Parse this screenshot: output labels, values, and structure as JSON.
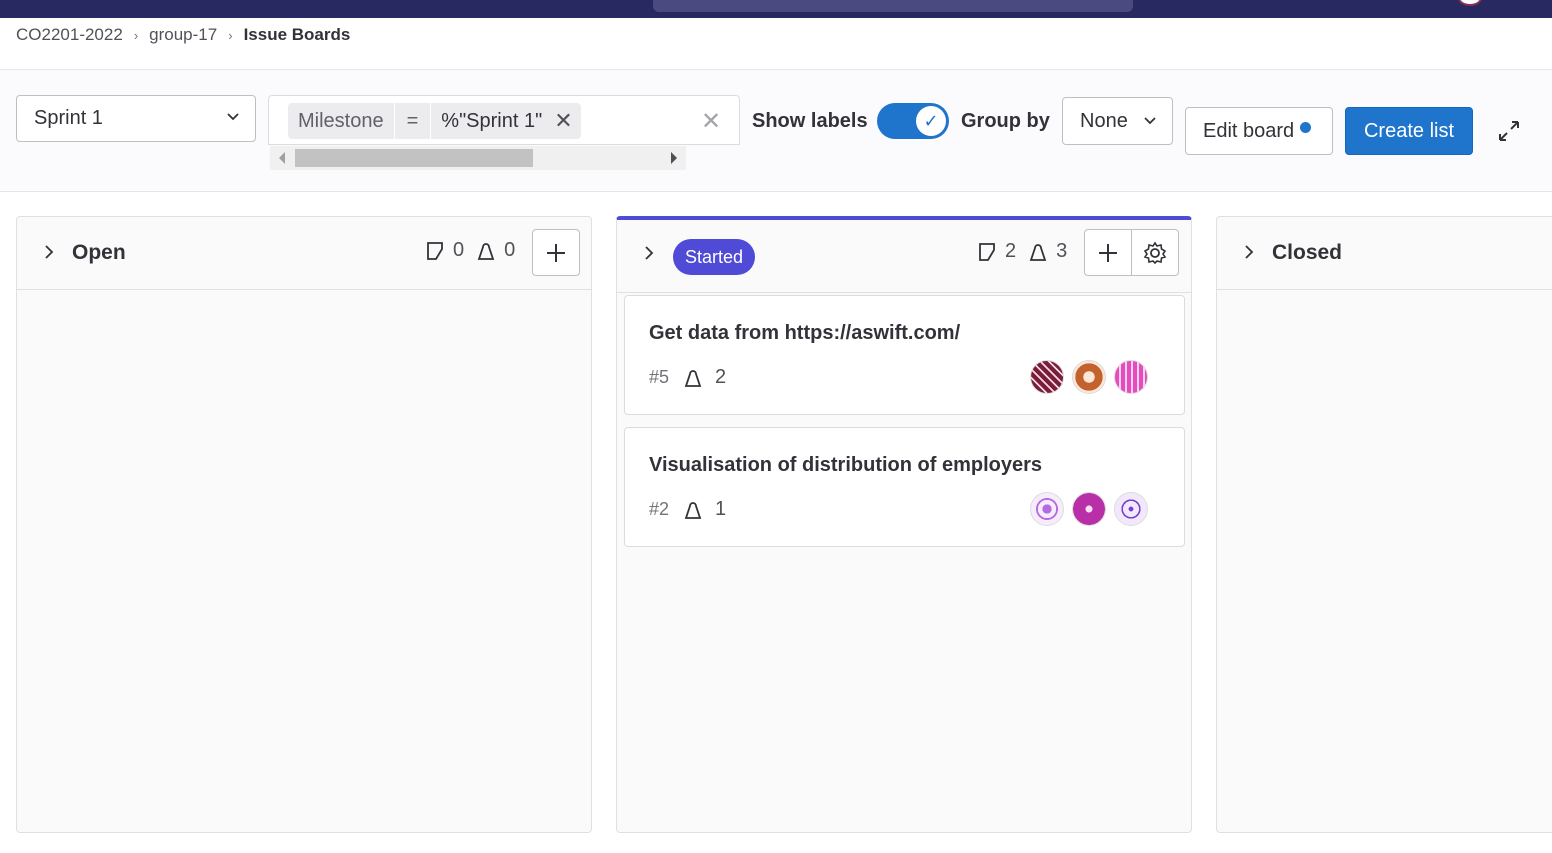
{
  "breadcrumb": {
    "items": [
      "CO2201-2022",
      "group-17",
      "Issue Boards"
    ]
  },
  "toolbar": {
    "milestone_select": "Sprint 1",
    "filter_token": {
      "key": "Milestone",
      "operator": "=",
      "value": "%\"Sprint 1\""
    },
    "show_labels_label": "Show labels",
    "show_labels_on": true,
    "group_by_label": "Group by",
    "group_by_value": "None",
    "edit_board_label": "Edit board",
    "create_list_label": "Create list"
  },
  "lists": {
    "open": {
      "title": "Open",
      "issue_count": "0",
      "weight": "0"
    },
    "started": {
      "title": "Started",
      "issue_count": "2",
      "weight": "3"
    },
    "closed": {
      "title": "Closed"
    }
  },
  "cards": [
    {
      "title": "Get data from https://aswift.com/",
      "number": "#5",
      "weight": "2",
      "avatar_colors": [
        "#7a1d3a",
        "#c4622d",
        "#e64bbf"
      ]
    },
    {
      "title": "Visualisation of distribution of employers",
      "number": "#2",
      "weight": "1",
      "avatar_colors": [
        "#b36be0",
        "#b82fa8",
        "#7a3ed1"
      ]
    }
  ],
  "colors": {
    "accent": "#1f75cb",
    "started_label": "#4f4bd6",
    "topbar": "#292961"
  }
}
